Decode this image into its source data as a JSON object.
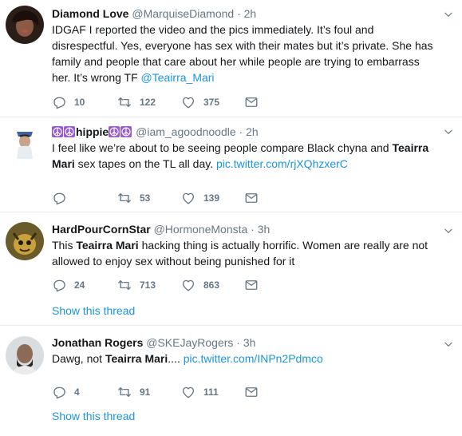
{
  "tweets": [
    {
      "name": "Diamond Love",
      "handle": "@MarquiseDiamond",
      "dot": "·",
      "time": "2h",
      "text_parts": [
        "IDGAF I reported the video and the pics immediately. It’s foul and disrespectful. Yes, everyone has sex with their mates but it’s private. She has family and people that care about her while people are trying to embarrass her. It’s wrong TF ",
        "@Teairra_Mari"
      ],
      "replies": "10",
      "retweets": "122",
      "likes": "375"
    },
    {
      "name": "hippie",
      "handle": "@iam_agoodnoodle",
      "dot": "·",
      "time": "2h",
      "text_parts": [
        "I feel like we’re about to be seeing people compare Black chyna and ",
        "Teairra Mari",
        " sex tapes on the TL all day. ",
        "pic.twitter.com/rjXQhzxerC"
      ],
      "replies": "",
      "retweets": "53",
      "likes": "139"
    },
    {
      "name": "HardPourCornStar",
      "handle": "@HormoneMonsta",
      "dot": "·",
      "time": "3h",
      "text_parts": [
        "This ",
        "Teairra Mari",
        " hacking thing is actually horrific. Women are really are not allowed to enjoy sex without being punished for it"
      ],
      "replies": "24",
      "retweets": "713",
      "likes": "863",
      "show_thread": "Show this thread"
    },
    {
      "name": "Jonathan Rogers",
      "handle": "@SKEJayRogers",
      "dot": "·",
      "time": "3h",
      "text_parts": [
        "Dawg, not ",
        "Teairra Mari",
        ".... ",
        "pic.twitter.com/INPn2Pdmco"
      ],
      "replies": "4",
      "retweets": "91",
      "likes": "111",
      "show_thread": "Show this thread"
    }
  ],
  "icons": {
    "reply": "reply-icon",
    "retweet": "retweet-icon",
    "like": "heart-icon",
    "message": "envelope-icon",
    "caret": "chevron-down-icon",
    "peace": "peace-symbol-icon"
  },
  "colors": {
    "link": "#1b95e0",
    "secondary_text": "#657786",
    "divider": "#e6ecf0",
    "peace_badge": "#9b59d0"
  }
}
